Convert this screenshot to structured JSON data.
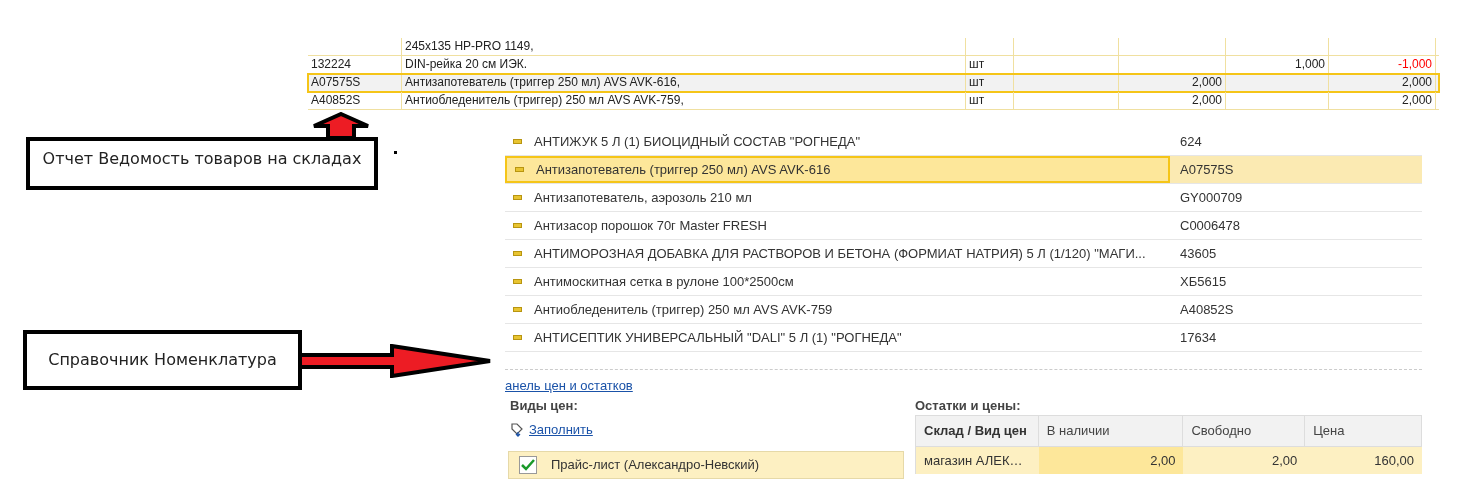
{
  "report": {
    "rows": [
      {
        "code": "",
        "name": "245x135 HP-PRO 1149,",
        "unit": "",
        "column_4": "",
        "column_5": "",
        "column_6": "",
        "column_7": "",
        "selected": false
      },
      {
        "code": "132224",
        "name": "DIN-рейка 20 см ИЭК.",
        "unit": "шт",
        "column_4": "",
        "column_5": "",
        "column_6": "1,000",
        "column_7": "-1,000",
        "selected": false,
        "negative": true
      },
      {
        "code": "A07575S",
        "name": "Антизапотеватель (триггер 250 мл) AVS AVK-616,",
        "unit": "шт",
        "column_4": "",
        "column_5": "2,000",
        "column_6": "",
        "column_7": "2,000",
        "selected": true
      },
      {
        "code": "A40852S",
        "name": "Антиобледенитель (триггер) 250 мл AVS AVK-759,",
        "unit": "шт",
        "column_4": "",
        "column_5": "2,000",
        "column_6": "",
        "column_7": "2,000",
        "selected": false
      }
    ]
  },
  "annotations": [
    {
      "kind": "up",
      "text": "Отчет Ведомость товаров на складах"
    },
    {
      "kind": "right",
      "text": "Справочник Номенклатура"
    }
  ],
  "nomenclature": {
    "rows": [
      {
        "name": "АНТИЖУК  5 Л (1)  БИОЦИДНЫЙ СОСТАВ  \"РОГНЕДА\"",
        "code": "624",
        "selected": false
      },
      {
        "name": "Антизапотеватель (триггер 250 мл) AVS AVK-616",
        "code": "A07575S",
        "selected": true
      },
      {
        "name": "Антизапотеватель, аэрозоль 210 мл",
        "code": "GY000709",
        "selected": false
      },
      {
        "name": "Антизасор порошок 70г Master FRESH",
        "code": "C0006478",
        "selected": false
      },
      {
        "name": "АНТИМОРОЗНАЯ ДОБАВКА ДЛЯ РАСТВОРОВ И БЕТОНА (ФОРМИАТ НАТРИЯ)  5 Л (1/120) \"МАГИ...",
        "code": "43605",
        "selected": false
      },
      {
        "name": "Антимоскитная сетка в  рулоне 100*2500см",
        "code": "ХБ5615",
        "selected": false
      },
      {
        "name": "Антиобледенитель (триггер) 250 мл AVS AVK-759",
        "code": "A40852S",
        "selected": false
      },
      {
        "name": "АНТИСЕПТИК УНИВЕРСАЛЬНЫЙ \"DALI\" 5 Л (1) \"РОГНЕДА\"",
        "code": "17634",
        "selected": false
      }
    ]
  },
  "panel": {
    "link": "анель цен и остатков",
    "price_types": {
      "title": "Виды цен:",
      "fill_link": "Заполнить",
      "items": [
        {
          "label": "Прайс-лист (Александро-Невский)",
          "checked": true
        }
      ]
    },
    "stock": {
      "title": "Остатки и цены:",
      "columns": [
        "Склад / Вид цен",
        "В наличии",
        "Свободно",
        "Цена"
      ],
      "rows": [
        [
          "магазин АЛЕК…",
          "2,00",
          "2,00",
          "160,00"
        ]
      ]
    }
  }
}
